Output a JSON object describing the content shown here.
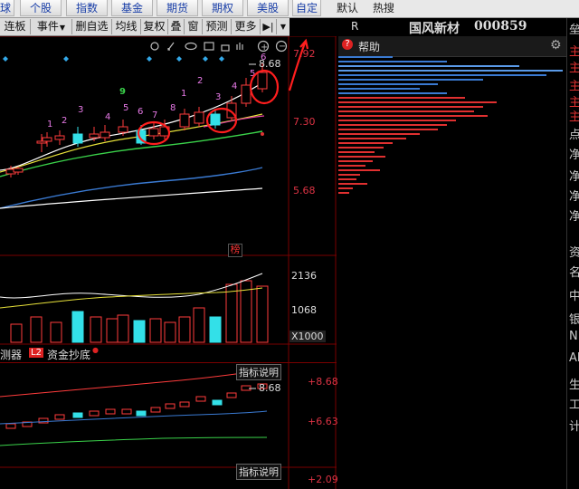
{
  "top_tabs": {
    "t0": "球",
    "t1": "个股",
    "t2": "指数",
    "t3": "基金",
    "t4": "期货",
    "t5": "期权",
    "t6": "美股",
    "t7": "自定",
    "t8": "默认",
    "t9": "热搜"
  },
  "toolbar": {
    "lianban": "连板",
    "shijian": "事件",
    "shanzixuan": "删自选",
    "junxian": "均线",
    "fuquan": "复权",
    "die": "叠",
    "chuang": "窗",
    "yuce": "预测",
    "gengduo": "更多"
  },
  "chart": {
    "price_high_label": "8.68",
    "axis_top": "7.92",
    "axis_mid": "7.30",
    "axis_low": "5.68",
    "bang": "榜",
    "vol_top": "2136",
    "vol_mid": "1068",
    "vol_unit": "X1000",
    "indicator_tab1": "测器",
    "indicator_l2": "L2",
    "indicator_tab2": "资金抄底",
    "indicator_explain": "指标说明",
    "lower_high_label": "8.68",
    "lower_axis1": "+8.68",
    "lower_axis2": "+6.63",
    "lower_axis3": "+2.09",
    "day_counts": [
      "1",
      "2",
      "3",
      "4",
      "5",
      "6",
      "7",
      "8",
      "9",
      "1",
      "2",
      "3",
      "4",
      "5",
      "6"
    ],
    "colors": {
      "up": "#ff3c3c",
      "down": "#33e0e8",
      "ma_white": "#ffffff",
      "ma_yellow": "#e8e23a",
      "ma_green": "#3ad24a",
      "ma_blue": "#3a7ad2",
      "annot": "#ff1e1e"
    }
  },
  "right_panel": {
    "header_r": "R",
    "stock_name": "国风新材",
    "stock_code": "000859",
    "help": "帮助"
  },
  "far_column": [
    "垒",
    "主",
    "主",
    "主",
    "主",
    "主",
    "点",
    "净",
    "净",
    "净",
    "净",
    "资",
    "名",
    "中",
    "银",
    "N",
    "Al",
    "生",
    "工",
    "计"
  ]
}
